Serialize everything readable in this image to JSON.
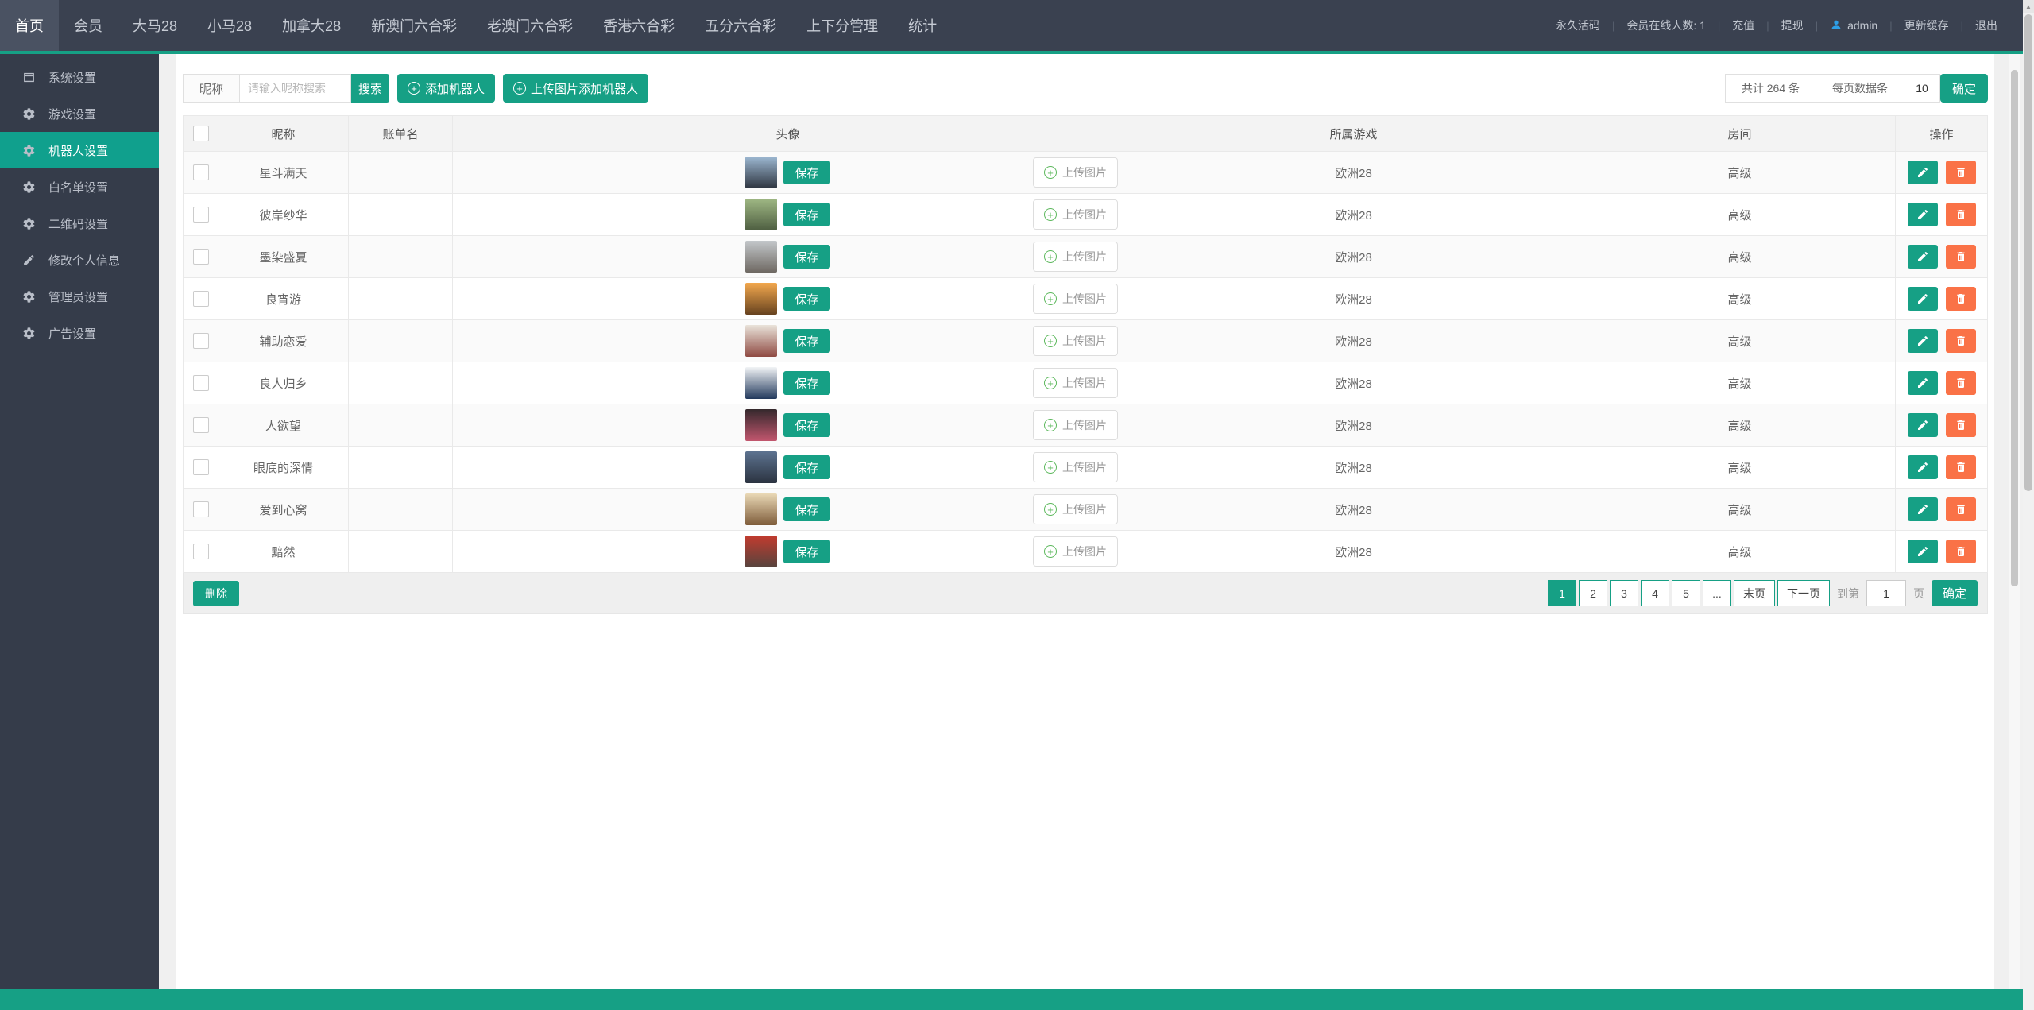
{
  "colors": {
    "accent_teal": "#16a085",
    "danger_orange": "#fa7247",
    "navbar_bg": "#3a4150",
    "navbar_active_bg": "#4a5262",
    "sidebar_bg": "#353c4a",
    "sidebar_active_bg": "#10a08d",
    "admin_icon_blue": "#2d9fe8",
    "upload_plus_green": "#5cb85c"
  },
  "navbar": {
    "items": [
      {
        "label": "首页",
        "active": true
      },
      {
        "label": "会员"
      },
      {
        "label": "大马28"
      },
      {
        "label": "小马28"
      },
      {
        "label": "加拿大28"
      },
      {
        "label": "新澳门六合彩"
      },
      {
        "label": "老澳门六合彩"
      },
      {
        "label": "香港六合彩"
      },
      {
        "label": "五分六合彩"
      },
      {
        "label": "上下分管理"
      },
      {
        "label": "统计"
      }
    ],
    "right_items": [
      {
        "label": "永久活码",
        "interactable": true
      },
      {
        "label": "会员在线人数: 1",
        "interactable": false
      },
      {
        "label": "充值",
        "interactable": true
      },
      {
        "label": "提现",
        "interactable": true
      },
      {
        "label": "admin",
        "icon": "user-icon",
        "interactable": true
      },
      {
        "label": "更新缓存",
        "interactable": true
      },
      {
        "label": "退出",
        "interactable": true
      }
    ]
  },
  "sidebar": {
    "items": [
      {
        "label": "系统设置",
        "icon": "window-icon"
      },
      {
        "label": "游戏设置",
        "icon": "gear-icon"
      },
      {
        "label": "机器人设置",
        "icon": "gear-icon",
        "active": true
      },
      {
        "label": "白名单设置",
        "icon": "gear-icon"
      },
      {
        "label": "二维码设置",
        "icon": "gear-icon"
      },
      {
        "label": "修改个人信息",
        "icon": "pencil-icon"
      },
      {
        "label": "管理员设置",
        "icon": "gear-icon"
      },
      {
        "label": "广告设置",
        "icon": "gear-icon"
      }
    ]
  },
  "toolbar": {
    "filter_label": "昵称",
    "search_placeholder": "请输入昵称搜索",
    "search_btn": "搜索",
    "add_robot_btn": "添加机器人",
    "upload_add_robot_btn": "上传图片添加机器人",
    "total_count": "共计 264 条",
    "per_page_label": "每页数据条",
    "per_page_value": "10",
    "confirm_btn": "确定"
  },
  "table": {
    "headers": [
      "昵称",
      "账单名",
      "头像",
      "所属游戏",
      "房间",
      "操作"
    ],
    "save_btn": "保存",
    "upload_btn": "上传图片",
    "rows": [
      {
        "nickname": "星斗满天",
        "account": "",
        "game": "欧洲28",
        "room": "高级",
        "avatar": [
          "#9db8d2",
          "#2e3540"
        ]
      },
      {
        "nickname": "彼岸纱华",
        "account": "",
        "game": "欧洲28",
        "room": "高级",
        "avatar": [
          "#9fb884",
          "#4e5e41"
        ]
      },
      {
        "nickname": "墨染盛夏",
        "account": "",
        "game": "欧洲28",
        "room": "高级",
        "avatar": [
          "#c3c7ca",
          "#6e6862"
        ]
      },
      {
        "nickname": "良宵游",
        "account": "",
        "game": "欧洲28",
        "room": "高级",
        "avatar": [
          "#f3a84e",
          "#66421f"
        ]
      },
      {
        "nickname": "辅助恋爱",
        "account": "",
        "game": "欧洲28",
        "room": "高级",
        "avatar": [
          "#e9e3da",
          "#8f4a42"
        ]
      },
      {
        "nickname": "良人归乡",
        "account": "",
        "game": "欧洲28",
        "room": "高级",
        "avatar": [
          "#f2f4f6",
          "#22395c"
        ]
      },
      {
        "nickname": "人欲望",
        "account": "",
        "game": "欧洲28",
        "room": "高级",
        "avatar": [
          "#34282c",
          "#c2566e"
        ]
      },
      {
        "nickname": "眼底的深情",
        "account": "",
        "game": "欧洲28",
        "room": "高级",
        "avatar": [
          "#5d7390",
          "#2b3340"
        ]
      },
      {
        "nickname": "爱到心窝",
        "account": "",
        "game": "欧洲28",
        "room": "高级",
        "avatar": [
          "#ead9b6",
          "#7e5c3a"
        ]
      },
      {
        "nickname": "黯然",
        "account": "",
        "game": "欧洲28",
        "room": "高级",
        "avatar": [
          "#c23b2e",
          "#57443e"
        ]
      }
    ]
  },
  "footer": {
    "delete_btn": "删除",
    "pages": [
      {
        "label": "1",
        "active": true
      },
      {
        "label": "2"
      },
      {
        "label": "3"
      },
      {
        "label": "4"
      },
      {
        "label": "5"
      },
      {
        "label": "..."
      },
      {
        "label": "末页"
      },
      {
        "label": "下一页"
      }
    ],
    "goto_label": "到第",
    "goto_value": "1",
    "page_unit": "页",
    "confirm_btn": "确定"
  }
}
